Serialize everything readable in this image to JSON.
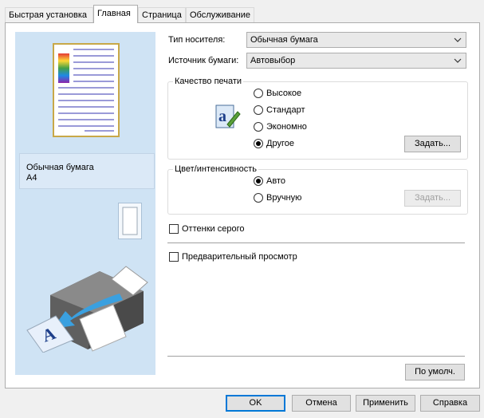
{
  "tabs": [
    "Быстрая установка",
    "Главная",
    "Страница",
    "Обслуживание"
  ],
  "active_tab": "Главная",
  "preview": {
    "media_name": "Обычная бумага",
    "paper_size": "A4"
  },
  "media_type": {
    "label": "Тип носителя:",
    "value": "Обычная бумага"
  },
  "paper_source": {
    "label": "Источник бумаги:",
    "value": "Автовыбор"
  },
  "print_quality": {
    "title": "Качество печати",
    "options": [
      "Высокое",
      "Стандарт",
      "Экономно",
      "Другое"
    ],
    "selected": "Другое",
    "set_label": "Задать..."
  },
  "color_intensity": {
    "title": "Цвет/интенсивность",
    "options": [
      "Авто",
      "Вручную"
    ],
    "selected": "Авто",
    "set_label": "Задать..."
  },
  "grayscale": {
    "label": "Оттенки серого",
    "checked": false
  },
  "preview_before_print": {
    "label": "Предварительный просмотр",
    "checked": false
  },
  "defaults_label": "По умолч.",
  "footer": {
    "ok": "OK",
    "cancel": "Отмена",
    "apply": "Применить",
    "help": "Справка"
  }
}
